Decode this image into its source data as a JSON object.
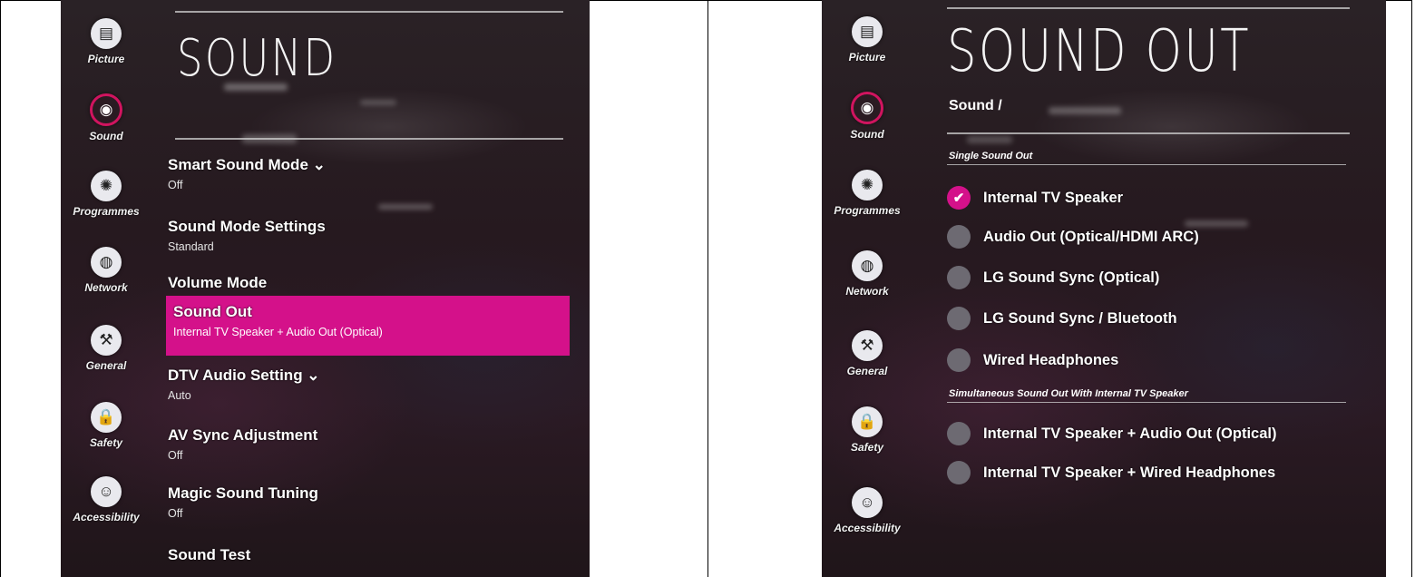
{
  "left_screen": {
    "title": "SOUND",
    "nav": [
      {
        "label": "Picture",
        "icon": "picture-icon",
        "glyph": "▤"
      },
      {
        "label": "Sound",
        "icon": "sound-icon",
        "glyph": "◉",
        "active": true
      },
      {
        "label": "Programmes",
        "icon": "programmes-icon",
        "glyph": "✺"
      },
      {
        "label": "Network",
        "icon": "network-icon",
        "glyph": "◍"
      },
      {
        "label": "General",
        "icon": "general-icon",
        "glyph": "⚒"
      },
      {
        "label": "Safety",
        "icon": "safety-icon",
        "glyph": "🔒"
      },
      {
        "label": "Accessibility",
        "icon": "accessibility-icon",
        "glyph": "☺"
      }
    ],
    "menu": [
      {
        "title": "Smart Sound Mode ⌄",
        "sub": "Off"
      },
      {
        "title": "Sound Mode Settings",
        "sub": "Standard"
      },
      {
        "title": "Volume Mode",
        "sub": ""
      },
      {
        "title": "Sound Out",
        "sub": "Internal TV Speaker + Audio Out (Optical)",
        "selected": true
      },
      {
        "title": "DTV Audio Setting ⌄",
        "sub": "Auto"
      },
      {
        "title": "AV Sync Adjustment",
        "sub": "Off"
      },
      {
        "title": "Magic Sound Tuning",
        "sub": "Off"
      },
      {
        "title": "Sound Test",
        "sub": ""
      }
    ]
  },
  "right_screen": {
    "title": "SOUND OUT",
    "breadcrumb": "Sound /",
    "single_label": "Single Sound Out",
    "single_options": [
      {
        "label": "Internal TV Speaker",
        "checked": true
      },
      {
        "label": "Audio Out (Optical/HDMI ARC)",
        "checked": false
      },
      {
        "label": "LG Sound Sync (Optical)",
        "checked": false
      },
      {
        "label": "LG Sound Sync / Bluetooth",
        "checked": false
      },
      {
        "label": "Wired Headphones",
        "checked": false
      }
    ],
    "simul_label": "Simultaneous Sound Out With Internal TV Speaker",
    "simul_options": [
      {
        "label": "Internal TV Speaker + Audio Out (Optical)",
        "checked": false
      },
      {
        "label": "Internal TV Speaker + Wired Headphones",
        "checked": false
      }
    ]
  },
  "colors": {
    "accent": "#d4118a",
    "screen_bg": "#26191f"
  }
}
